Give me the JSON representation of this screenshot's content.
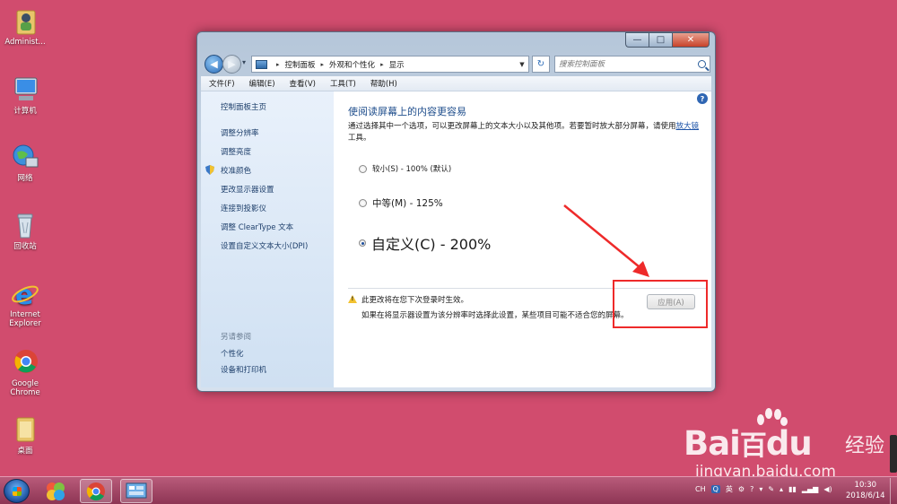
{
  "desktop": {
    "icons": [
      {
        "label": "Administ..."
      },
      {
        "label": "计算机"
      },
      {
        "label": "网络"
      },
      {
        "label": "回收站"
      },
      {
        "label": "Internet Explorer"
      },
      {
        "label": "Google Chrome"
      },
      {
        "label": "桌面"
      }
    ]
  },
  "window": {
    "controls": {
      "minimize": "—",
      "maximize": "□",
      "close": "✕"
    },
    "breadcrumbs": [
      "控制面板",
      "外观和个性化",
      "显示"
    ],
    "search_placeholder": "搜索控制面板",
    "menu": [
      "文件(F)",
      "编辑(E)",
      "查看(V)",
      "工具(T)",
      "帮助(H)"
    ],
    "sidebar": {
      "home": "控制面板主页",
      "links": [
        "调整分辨率",
        "调整亮度",
        "校准颜色",
        "更改显示器设置",
        "连接到投影仪",
        "调整 ClearType 文本",
        "设置自定义文本大小(DPI)"
      ],
      "see_also_title": "另请参阅",
      "see_also": [
        "个性化",
        "设备和打印机"
      ]
    },
    "main": {
      "title": "使阅读屏幕上的内容更容易",
      "description_prefix": "通过选择其中一个选项，可以更改屏幕上的文本大小以及其他项。若要暂时放大部分屏幕，请使用",
      "description_link": "放大镜",
      "description_suffix": "工具。",
      "options": [
        {
          "label": "较小(S) - 100% (默认)",
          "checked": false
        },
        {
          "label": "中等(M) - 125%",
          "checked": false
        },
        {
          "label": "自定义(C) - 200%",
          "checked": true
        }
      ],
      "notice_line1": "此更改将在您下次登录时生效。",
      "notice_line2": "如果在将显示器设置为该分辨率时选择此设置，某些项目可能不适合您的屏幕。",
      "apply_label": "应用(A)",
      "apply_enabled": false
    }
  },
  "watermark": {
    "main": "Bai",
    "main2": "百",
    "main3": "du",
    "jingyan": "经验",
    "url": "jingyan.baidu.com"
  },
  "taskbar": {
    "tray": {
      "lang": "CH",
      "ime": "英"
    },
    "time": "10:30",
    "date": "2018/6/14"
  },
  "colors": {
    "desktop": "#d14c6e",
    "annotation": "#ee2a2a",
    "link": "#1e3f6b",
    "title": "#1f4e8c"
  }
}
